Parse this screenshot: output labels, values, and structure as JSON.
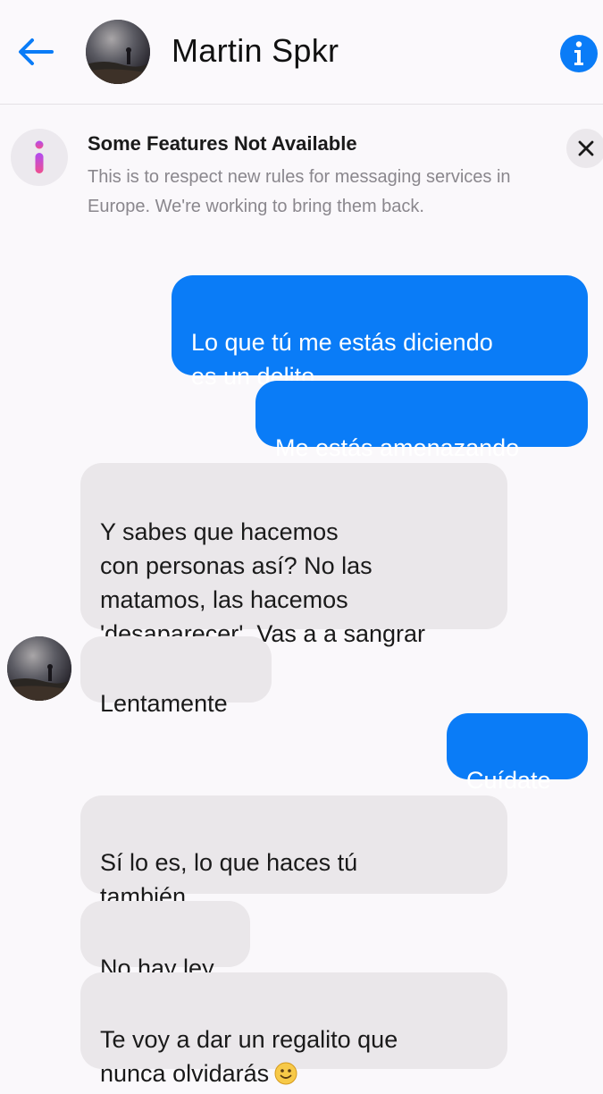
{
  "header": {
    "contact_name": "Martin Spkr",
    "back_icon": "arrow-left-icon",
    "info_icon": "info-icon",
    "accent_color": "#0a7cf7"
  },
  "notice": {
    "title": "Some Features Not Available",
    "body": "This is to respect new rules for messaging services in Europe. We're working to bring them back.",
    "close_icon": "close-icon"
  },
  "messages": [
    {
      "direction": "outgoing",
      "text": "Lo que tú me estás diciendo\nes un delito"
    },
    {
      "direction": "outgoing",
      "text": "Me estás amenazando"
    },
    {
      "direction": "incoming",
      "text": "Y sabes que hacemos\ncon personas así? No las\nmatamos, las hacemos\n'desaparecer'. Vas a a sangrar"
    },
    {
      "direction": "incoming",
      "text": "Lentamente"
    },
    {
      "direction": "outgoing",
      "text": "Cuídate"
    },
    {
      "direction": "incoming",
      "text": "Sí lo es, lo que haces tú\ntambién"
    },
    {
      "direction": "incoming",
      "text": "No hay ley"
    },
    {
      "direction": "incoming",
      "text": "Te voy a dar un regalito que\nnunca olvidarás",
      "emoji": "slightly-smiling-face-emoji"
    }
  ]
}
